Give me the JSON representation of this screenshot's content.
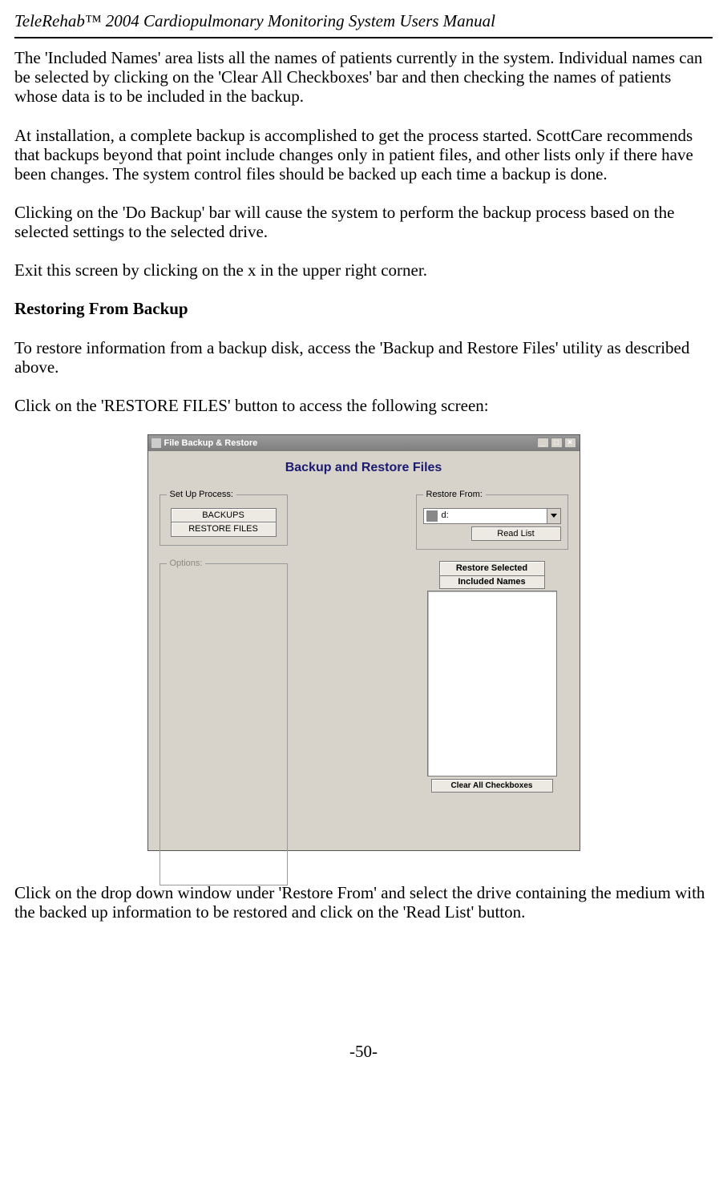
{
  "header": {
    "title_italic": "TeleRehab™ 2004 Cardiopulmonary Monitoring System Users Manual"
  },
  "paragraphs": {
    "p1": "The 'Included Names' area lists all the names of patients currently in the system. Individual names can be selected by clicking on the 'Clear All Checkboxes' bar and then checking the names of patients whose data is to be included in the backup.",
    "p2": "At installation, a complete backup is accomplished to get the process started. ScottCare recommends that backups beyond that point include changes only in patient files, and other lists only if there have been changes. The system control files should be backed up each time a backup is done.",
    "p3": "Clicking on the 'Do Backup' bar will cause the system to perform the backup process based on the selected settings to the selected drive.",
    "p4": "Exit this screen by clicking on the x in the upper right corner.",
    "heading": "Restoring From Backup",
    "p5": "To restore information from a backup disk, access the 'Backup and Restore Files' utility as described above.",
    "p6": "Click on the 'RESTORE FILES' button to access the following screen:",
    "p7": "Click on the drop down window under 'Restore From' and select the drive containing the medium with the backed up information to be restored and click on the 'Read List' button."
  },
  "screenshot": {
    "window_title": "File Backup & Restore",
    "dialog_title": "Backup and Restore Files",
    "setup_label": "Set Up Process:",
    "backups_btn": "BACKUPS",
    "restore_btn": "RESTORE FILES",
    "options_label": "Options:",
    "restore_from_label": "Restore From:",
    "drive_value": "d:",
    "read_list_btn": "Read List",
    "restore_selected_btn": "Restore Selected",
    "included_names_label": "Included Names",
    "clear_btn": "Clear All Checkboxes",
    "titlebar_min": "_",
    "titlebar_max": "□",
    "titlebar_close": "×"
  },
  "footer": {
    "page": "-50-"
  }
}
